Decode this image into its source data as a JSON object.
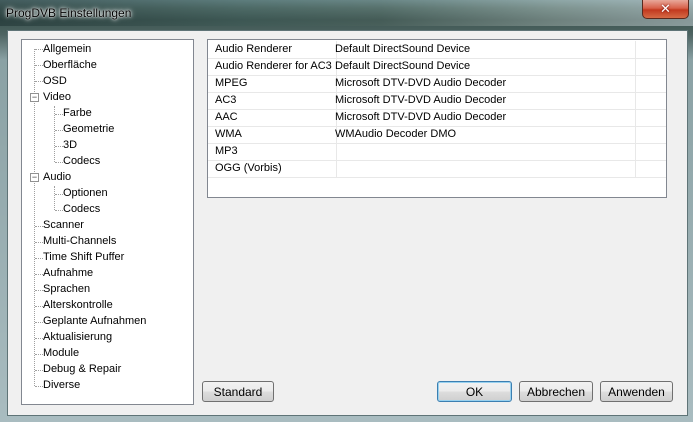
{
  "window": {
    "title": "ProgDVB Einstellungen",
    "close_glyph": "✕"
  },
  "tree": {
    "items": [
      {
        "label": "Allgemein"
      },
      {
        "label": "Oberfläche"
      },
      {
        "label": "OSD"
      },
      {
        "label": "Video",
        "expander": "−"
      },
      {
        "label": "Farbe"
      },
      {
        "label": "Geometrie"
      },
      {
        "label": "3D"
      },
      {
        "label": "Codecs"
      },
      {
        "label": "Audio",
        "expander": "−"
      },
      {
        "label": "Optionen"
      },
      {
        "label": "Codecs"
      },
      {
        "label": "Scanner"
      },
      {
        "label": "Multi-Channels"
      },
      {
        "label": "Time Shift Puffer"
      },
      {
        "label": "Aufnahme"
      },
      {
        "label": "Sprachen"
      },
      {
        "label": "Alterskontrolle"
      },
      {
        "label": "Geplante Aufnahmen"
      },
      {
        "label": "Aktualisierung"
      },
      {
        "label": "Module"
      },
      {
        "label": "Debug & Repair"
      },
      {
        "label": "Diverse"
      }
    ]
  },
  "grid": {
    "rows": [
      {
        "name": "Audio Renderer",
        "value": "Default DirectSound Device"
      },
      {
        "name": "Audio Renderer for AC3",
        "value": "Default DirectSound Device"
      },
      {
        "name": "MPEG",
        "value": "Microsoft DTV-DVD Audio Decoder"
      },
      {
        "name": "AC3",
        "value": "Microsoft DTV-DVD Audio Decoder"
      },
      {
        "name": "AAC",
        "value": "Microsoft DTV-DVD Audio Decoder"
      },
      {
        "name": "WMA",
        "value": "WMAudio Decoder DMO"
      },
      {
        "name": "MP3",
        "value": ""
      },
      {
        "name": "OGG (Vorbis)",
        "value": ""
      }
    ]
  },
  "buttons": {
    "standard": "Standard",
    "ok": "OK",
    "cancel": "Abbrechen",
    "apply": "Anwenden"
  }
}
